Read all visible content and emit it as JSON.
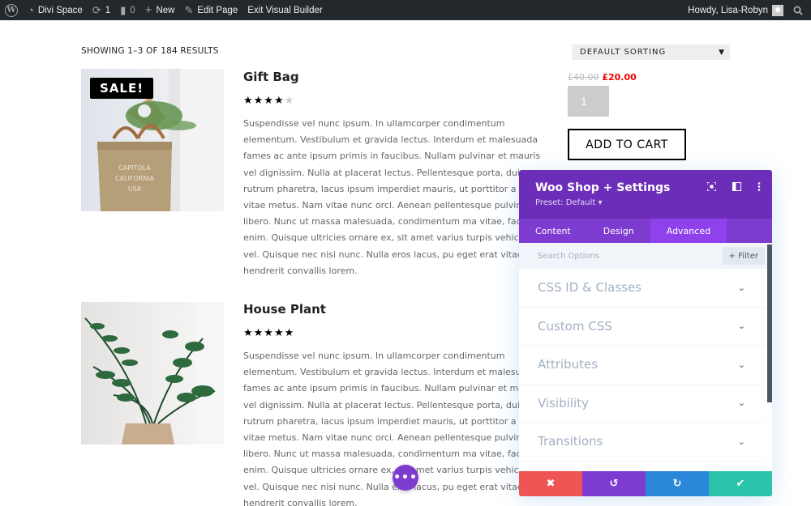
{
  "adminbar": {
    "site_name": "Divi Space",
    "updates_count": "1",
    "comments_count": "0",
    "new_label": "New",
    "edit_label": "Edit Page",
    "exit_label": "Exit Visual Builder",
    "howdy": "Howdy, Lisa-Robyn"
  },
  "shop": {
    "results_text": "SHOWING 1–3 OF 184 RESULTS",
    "sorting_selected": "DEFAULT SORTING",
    "sale_badge": "SALE!",
    "products": [
      {
        "title": "Gift Bag",
        "rating": 4,
        "rating_max": 5,
        "stars_full": "★★★★",
        "stars_empty": "★",
        "description": "Suspendisse vel nunc ipsum. In ullamcorper condimentum elementum. Vestibulum et gravida lectus. Interdum et malesuada fames ac ante ipsum primis in faucibus. Nullam pulvinar et mauris vel dignissim. Nulla at placerat lectus. Pellentesque porta, dui rutrum pharetra, lacus ipsum imperdiet mauris, ut porttitor a erat vitae metus. Nam vitae nunc orci. Aenean pellentesque pulvinar libero. Nunc ut massa malesuada, condimentum ma vitae, facilisis enim. Quisque ultricies ornare ex, sit amet varius turpis vehicula vel. Quisque nec nisi nunc. Nulla eros lacus, pu eget erat vitae, hendrerit convallis lorem.",
        "price_old": "£40.00",
        "price_new": "£20.00",
        "quantity": "1",
        "add_to_cart": "ADD TO CART"
      },
      {
        "title": "House Plant",
        "rating": 5,
        "rating_max": 5,
        "stars_full": "★★★★★",
        "stars_empty": "",
        "description": "Suspendisse vel nunc ipsum. In ullamcorper condimentum elementum. Vestibulum et gravida lectus. Interdum et malesuada fames ac ante ipsum primis in faucibus. Nullam pulvinar et mauris vel dignissim. Nulla at placerat lectus. Pellentesque porta, dui rutrum pharetra, lacus ipsum imperdiet mauris, ut porttitor a erat vitae metus. Nam vitae nunc orci. Aenean pellentesque pulvinar libero. Nunc ut massa malesuada, condimentum ma vitae, facilisis enim. Quisque ultricies ornare ex, sit amet varius turpis vehicula vel. Quisque nec nisi nunc. Nulla eros lacus, pu eget erat vitae, hendrerit convallis lorem."
      }
    ]
  },
  "panel": {
    "title": "Woo Shop + Settings",
    "preset": "Preset: Default ▾",
    "tabs": [
      {
        "label": "Content"
      },
      {
        "label": "Design"
      },
      {
        "label": "Advanced",
        "active": true
      }
    ],
    "search_placeholder": "Search Options",
    "filter_label": "+ Filter",
    "sections": [
      {
        "label": "CSS ID & Classes"
      },
      {
        "label": "Custom CSS"
      },
      {
        "label": "Attributes"
      },
      {
        "label": "Visibility"
      },
      {
        "label": "Transitions"
      }
    ],
    "footer_colors": {
      "discard": "#ef5555",
      "undo": "#7e3bd0",
      "redo": "#2b87da",
      "save": "#29c4a9"
    }
  },
  "colors": {
    "accent_purple": "#6c2eb9",
    "sale_price": "#ee0000"
  }
}
